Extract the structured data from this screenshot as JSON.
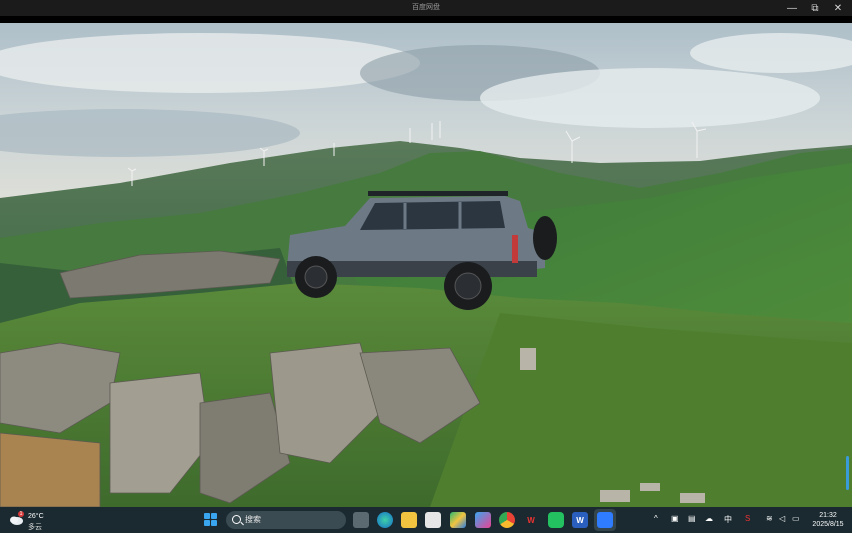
{
  "window": {
    "title": "百度网盘",
    "controls": {
      "minimize": "—",
      "maximize": "⧉",
      "close": "✕"
    }
  },
  "video": {
    "description_icons": [
      "scrubber-indicator"
    ]
  },
  "taskbar": {
    "weather": {
      "temperature": "26°C",
      "condition": "多云",
      "badge": "1"
    },
    "search_placeholder": "搜索",
    "apps": [
      {
        "name": "task-view-icon",
        "label": ""
      },
      {
        "name": "edge-icon",
        "label": ""
      },
      {
        "name": "file-explorer-icon",
        "label": ""
      },
      {
        "name": "store-icon",
        "label": ""
      },
      {
        "name": "drive-icon",
        "label": ""
      },
      {
        "name": "pictures-icon",
        "label": ""
      },
      {
        "name": "chrome-icon",
        "label": ""
      },
      {
        "name": "wps-icon",
        "label": "W"
      },
      {
        "name": "wechat-icon",
        "label": ""
      },
      {
        "name": "word-icon",
        "label": "W"
      },
      {
        "name": "baidu-netdisk-icon",
        "label": ""
      }
    ],
    "tray": {
      "ime": "中",
      "time": "21:32",
      "date": "2025/8/15"
    }
  }
}
